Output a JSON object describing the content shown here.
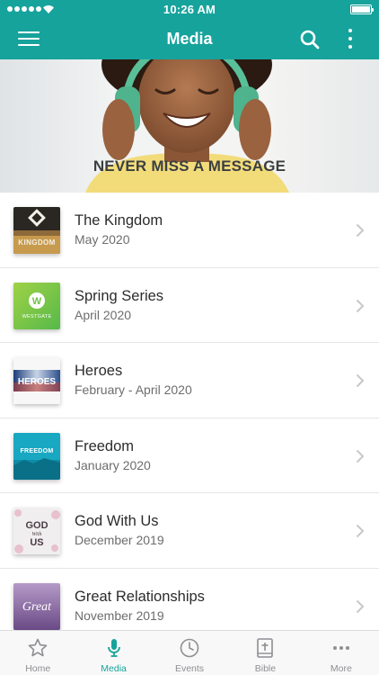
{
  "status_bar": {
    "time": "10:26 AM"
  },
  "nav": {
    "title": "Media"
  },
  "hero": {
    "caption": "NEVER MISS A MESSAGE"
  },
  "colors": {
    "accent": "#16a39c",
    "tab_inactive": "#8e8e93"
  },
  "series": [
    {
      "title": "The Kingdom",
      "date": "May 2020",
      "thumb_text": "KINGDOM"
    },
    {
      "title": "Spring Series",
      "date": "April 2020",
      "thumb_text": "WESTGATE"
    },
    {
      "title": "Heroes",
      "date": "February - April 2020",
      "thumb_text": "HEROES"
    },
    {
      "title": "Freedom",
      "date": "January 2020",
      "thumb_text": "FREEDOM"
    },
    {
      "title": "God With Us",
      "date": "December 2019",
      "thumb_text": "GOD With US"
    },
    {
      "title": "Great Relationships",
      "date": "November 2019",
      "thumb_text": "Great"
    }
  ],
  "tabs": [
    {
      "label": "Home",
      "icon": "star-icon"
    },
    {
      "label": "Media",
      "icon": "microphone-icon",
      "active": true
    },
    {
      "label": "Events",
      "icon": "clock-icon"
    },
    {
      "label": "Bible",
      "icon": "bible-icon"
    },
    {
      "label": "More",
      "icon": "ellipsis-icon"
    }
  ]
}
